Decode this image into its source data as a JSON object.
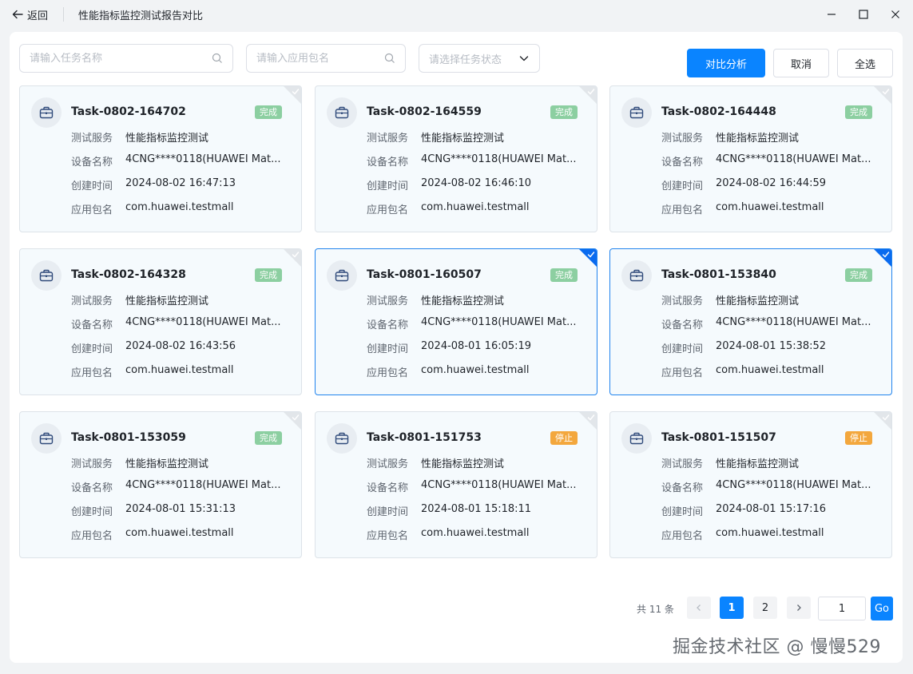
{
  "titlebar": {
    "back_label": "返回",
    "title": "性能指标监控测试报告对比"
  },
  "toolbar": {
    "task_search_placeholder": "请输入任务名称",
    "package_search_placeholder": "请输入应用包名",
    "status_select_placeholder": "请选择任务状态",
    "compare_label": "对比分析",
    "cancel_label": "取消",
    "select_all_label": "全选"
  },
  "field_labels": {
    "service": "测试服务",
    "device": "设备名称",
    "created": "创建时间",
    "package": "应用包名"
  },
  "status_colors": {
    "done": "#8ccfa1",
    "stopped": "#f3a73d",
    "accent": "#0a84ff"
  },
  "cards": [
    {
      "name": "Task-0802-164702",
      "status": "完成",
      "status_type": "done",
      "selected": false,
      "service": "性能指标监控测试",
      "device": "4CNG****0118(HUAWEI Mat...",
      "created": "2024-08-02 16:47:13",
      "package": "com.huawei.testmall"
    },
    {
      "name": "Task-0802-164559",
      "status": "完成",
      "status_type": "done",
      "selected": false,
      "service": "性能指标监控测试",
      "device": "4CNG****0118(HUAWEI Mat...",
      "created": "2024-08-02 16:46:10",
      "package": "com.huawei.testmall"
    },
    {
      "name": "Task-0802-164448",
      "status": "完成",
      "status_type": "done",
      "selected": false,
      "service": "性能指标监控测试",
      "device": "4CNG****0118(HUAWEI Mat...",
      "created": "2024-08-02 16:44:59",
      "package": "com.huawei.testmall"
    },
    {
      "name": "Task-0802-164328",
      "status": "完成",
      "status_type": "done",
      "selected": false,
      "service": "性能指标监控测试",
      "device": "4CNG****0118(HUAWEI Mat...",
      "created": "2024-08-02 16:43:56",
      "package": "com.huawei.testmall"
    },
    {
      "name": "Task-0801-160507",
      "status": "完成",
      "status_type": "done",
      "selected": true,
      "service": "性能指标监控测试",
      "device": "4CNG****0118(HUAWEI Mat...",
      "created": "2024-08-01 16:05:19",
      "package": "com.huawei.testmall"
    },
    {
      "name": "Task-0801-153840",
      "status": "完成",
      "status_type": "done",
      "selected": true,
      "service": "性能指标监控测试",
      "device": "4CNG****0118(HUAWEI Mat...",
      "created": "2024-08-01 15:38:52",
      "package": "com.huawei.testmall"
    },
    {
      "name": "Task-0801-153059",
      "status": "完成",
      "status_type": "done",
      "selected": false,
      "service": "性能指标监控测试",
      "device": "4CNG****0118(HUAWEI Mat...",
      "created": "2024-08-01 15:31:13",
      "package": "com.huawei.testmall"
    },
    {
      "name": "Task-0801-151753",
      "status": "停止",
      "status_type": "stopped",
      "selected": false,
      "service": "性能指标监控测试",
      "device": "4CNG****0118(HUAWEI Mat...",
      "created": "2024-08-01 15:18:11",
      "package": "com.huawei.testmall"
    },
    {
      "name": "Task-0801-151507",
      "status": "停止",
      "status_type": "stopped",
      "selected": false,
      "service": "性能指标监控测试",
      "device": "4CNG****0118(HUAWEI Mat...",
      "created": "2024-08-01 15:17:16",
      "package": "com.huawei.testmall"
    }
  ],
  "pagination": {
    "total_text": "共 11 条",
    "pages": [
      "1",
      "2"
    ],
    "current_page": "1",
    "jump_value": "1",
    "go_label": "Go"
  },
  "watermark": "掘金技术社区 @ 慢慢529"
}
